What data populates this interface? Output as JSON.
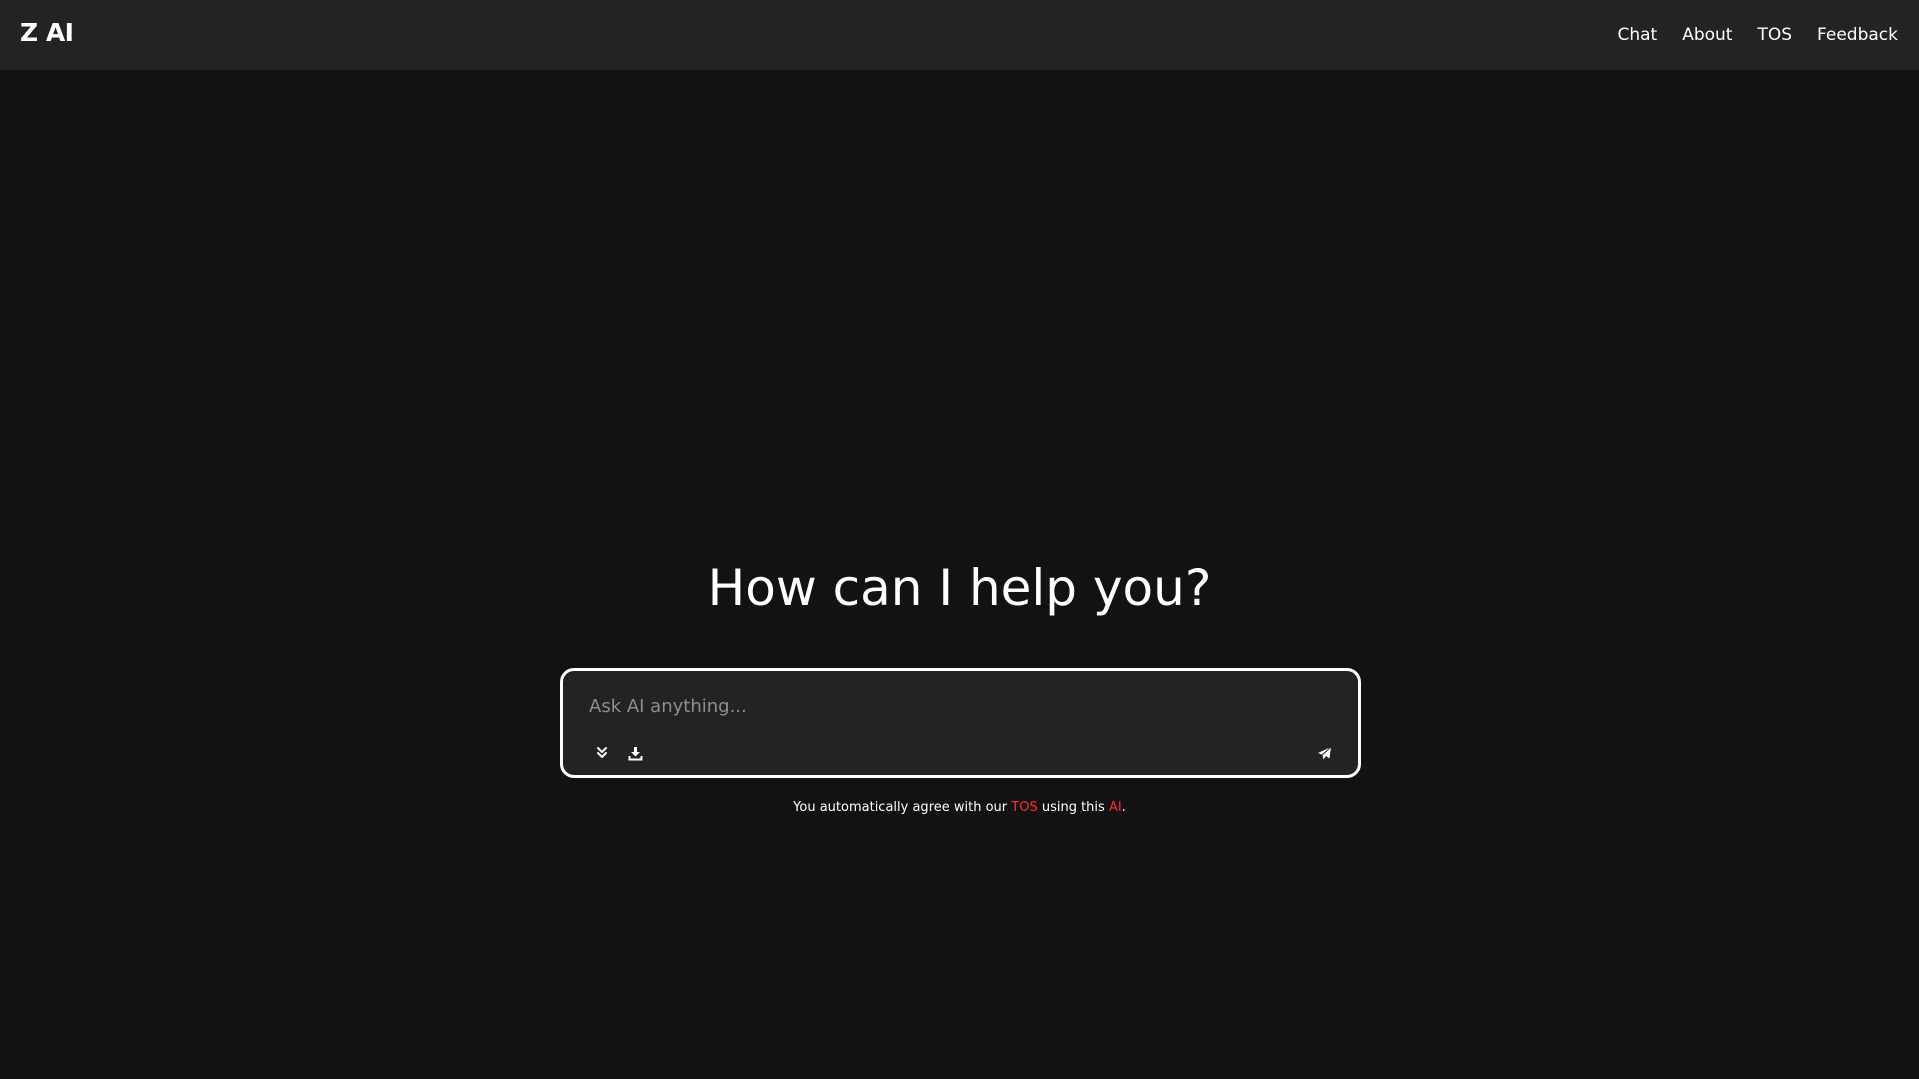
{
  "header": {
    "logo": "Z AI",
    "nav": [
      {
        "label": "Chat"
      },
      {
        "label": "About"
      },
      {
        "label": "TOS"
      },
      {
        "label": "Feedback"
      }
    ]
  },
  "main": {
    "heading": "How can I help you?",
    "input": {
      "placeholder": "Ask AI anything...",
      "value": ""
    },
    "toolbar": {
      "expand_icon": "chevrons-down-icon",
      "download_icon": "download-icon",
      "send_icon": "paper-plane-icon"
    },
    "disclaimer": {
      "prefix": "You automatically agree with our ",
      "tos_link": "TOS",
      "middle": " using this ",
      "ai_link": "AI",
      "suffix": "."
    }
  },
  "colors": {
    "background": "#121212",
    "header_bg": "#232323",
    "input_bg": "#232323",
    "accent_red": "#ff2a2a",
    "text": "#ffffff"
  }
}
